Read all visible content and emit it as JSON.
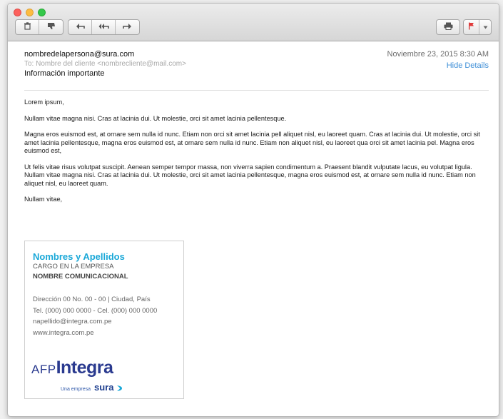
{
  "toolbar": {
    "buttons": [
      {
        "icon": "trash-icon",
        "glyph": "🗑"
      },
      {
        "icon": "junk-icon",
        "glyph": "👎"
      },
      {
        "icon": "reply-icon",
        "glyph": "↩"
      },
      {
        "icon": "reply-all-icon",
        "glyph": "⟲"
      },
      {
        "icon": "forward-icon",
        "glyph": "➜"
      },
      {
        "icon": "print-icon",
        "glyph": "🖨"
      },
      {
        "icon": "flag-icon",
        "glyph": "⚑"
      },
      {
        "icon": "chevron-down-icon",
        "glyph": "▾"
      }
    ]
  },
  "email": {
    "from": "nombredelapersona@sura.com",
    "to": "To: Nombre del cliente <nombrecliente@mail.com>",
    "subject": "Información importante",
    "date": "Noviembre 23, 2015 8:30 AM",
    "hide_details": "Hide Details",
    "paragraphs": [
      "Lorem ipsum,",
      "Nullam vitae magna nisi. Cras at lacinia dui. Ut molestie, orci sit amet lacinia pellentesque.",
      "Magna eros euismod est, at ornare sem nulla id nunc. Etiam non orci sit amet lacinia pell aliquet nisl, eu laoreet quam. Cras at lacinia dui. Ut molestie, orci sit amet lacinia pellentesque, magna eros euismod est, at ornare sem nulla id nunc. Etiam non aliquet nisl, eu laoreet qua orci sit amet lacinia pel. Magna eros euismod est,",
      "Ut felis vitae risus volutpat suscipit. Aenean semper tempor massa, non viverra sapien condimentum a. Praesent blandit vulputate lacus, eu volutpat ligula. Nullam vitae magna nisi. Cras at lacinia dui. Ut molestie, orci sit amet lacinia pellentesque, magna eros euismod est, at ornare sem nulla id nunc. Etiam non aliquet nisl, eu laoreet quam.",
      "Nullam vitae,"
    ]
  },
  "signature": {
    "name": "Nombres y Apellidos",
    "role": "CARGO EN LA EMPRESA",
    "department": "NOMBRE COMUNICACIONAL",
    "address": "Dirección 00 No. 00 - 00 | Ciudad, País",
    "phone": "Tel. (000) 000 0000 - Cel. (000) 000 0000",
    "email": "napellido@integra.com.pe",
    "website": "www.integra.com.pe",
    "logo_prefix": "AFP",
    "logo_main": "Integra",
    "tagline": "Una empresa",
    "parent_brand": "sura"
  },
  "colors": {
    "accent": "#1aa8d8",
    "brand": "#2a3a8f",
    "link": "#3f8fd7"
  }
}
